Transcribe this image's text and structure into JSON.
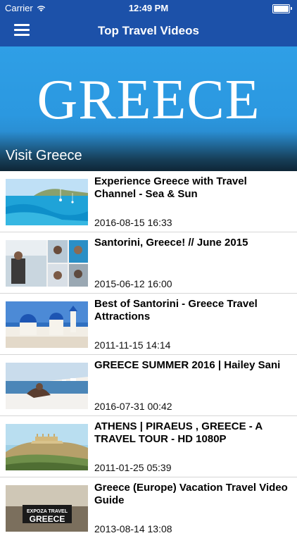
{
  "status_bar": {
    "carrier": "Carrier",
    "time": "12:49 PM"
  },
  "nav": {
    "title": "Top Travel Videos",
    "menu_icon": "hamburger-menu-icon"
  },
  "banner": {
    "word": "GREECE",
    "caption": "Visit Greece"
  },
  "videos": [
    {
      "title": "Experience Greece with Travel Channel - Sea & Sun",
      "date": "2016-08-15 16:33"
    },
    {
      "title": "Santorini, Greece! // June 2015",
      "date": "2015-06-12 16:00"
    },
    {
      "title": "Best of Santorini - Greece Travel Attractions",
      "date": "2011-11-15 14:14"
    },
    {
      "title": "GREECE SUMMER 2016 | Hailey Sani",
      "date": "2016-07-31 00:42"
    },
    {
      "title": "ATHENS | PIRAEUS , GREECE - A TRAVEL TOUR - HD 1080P",
      "date": "2011-01-25 05:39"
    },
    {
      "title": "Greece (Europe) Vacation Travel Video Guide",
      "date": "2013-08-14 13:08"
    }
  ],
  "thumb6_text": {
    "line1": "EXPOZA TRAVEL",
    "line2": "GREECE"
  },
  "colors": {
    "nav_bar": "#1c51a9",
    "banner_blue": "#2b98e0"
  }
}
